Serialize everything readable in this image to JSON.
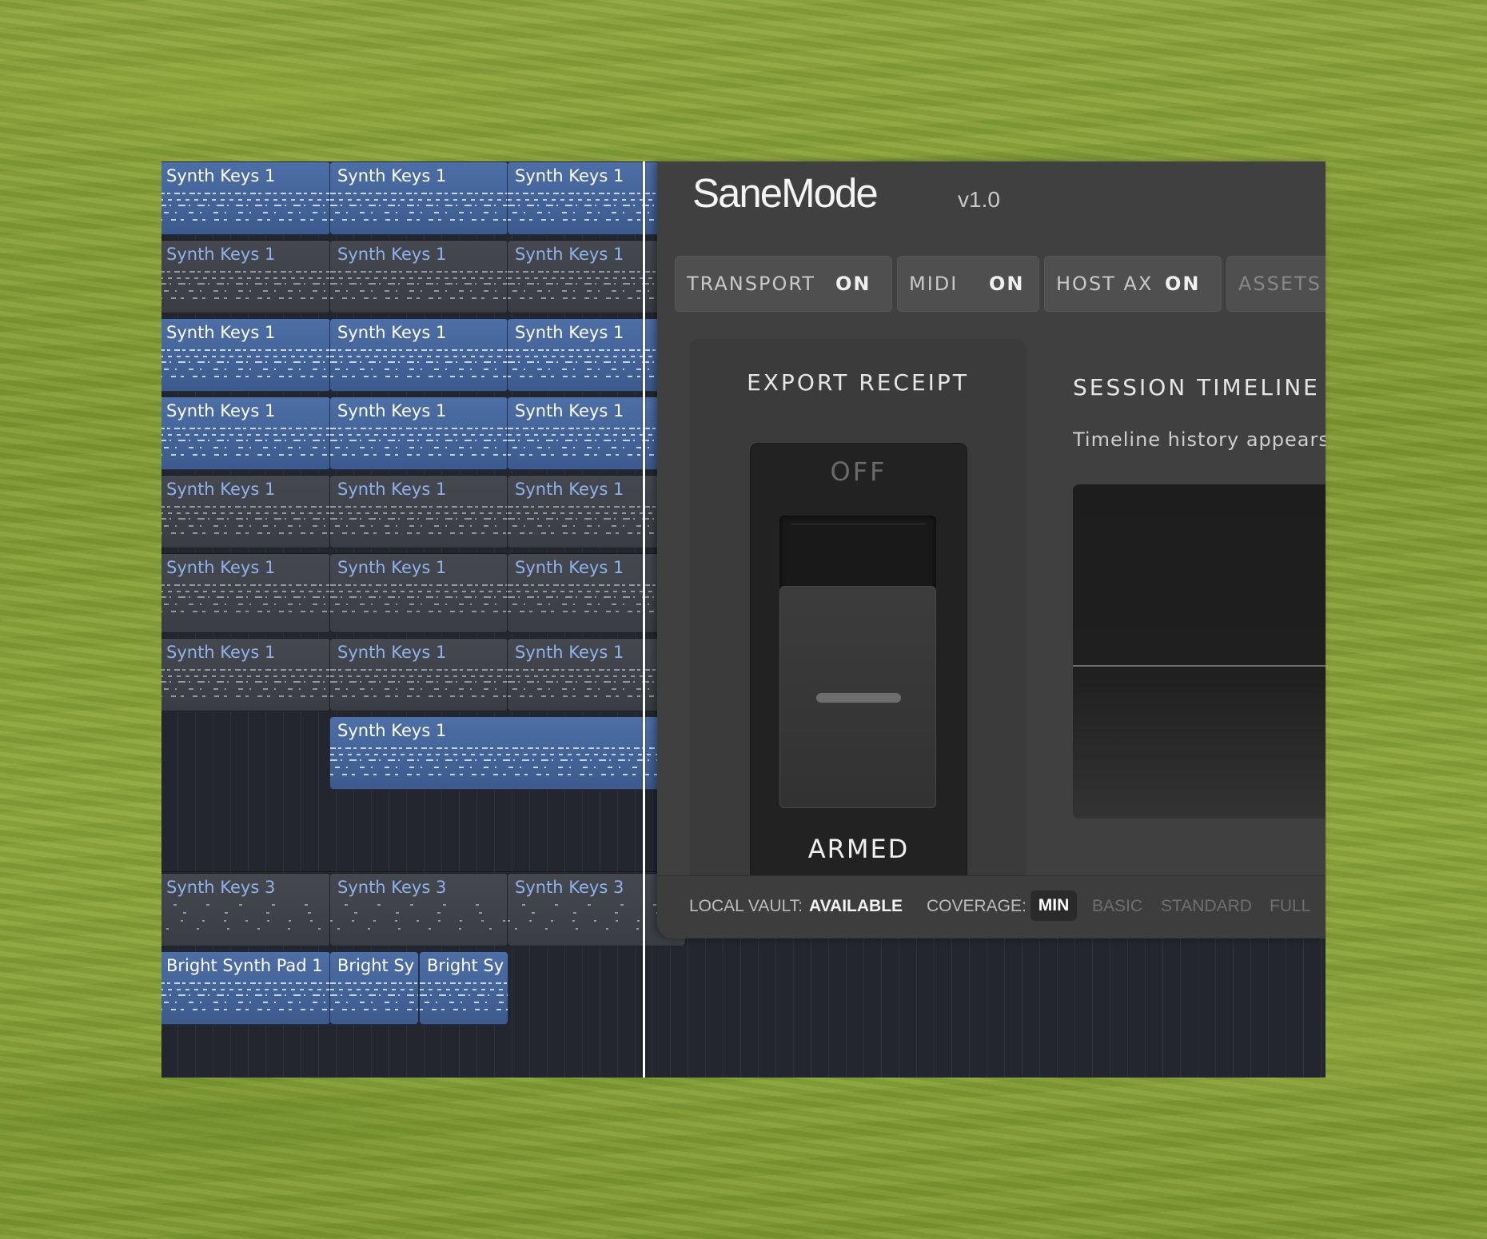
{
  "daw": {
    "rows": [
      {
        "style": "blue",
        "clips": [
          "Synth Keys 1",
          "Synth Keys 1",
          "Synth Keys 1"
        ]
      },
      {
        "style": "gray",
        "clips": [
          "Synth Keys 1",
          "Synth Keys 1",
          "Synth Keys 1"
        ]
      },
      {
        "style": "blue",
        "clips": [
          "Synth Keys 1",
          "Synth Keys 1",
          "Synth Keys 1"
        ]
      },
      {
        "style": "blue",
        "clips": [
          "Synth Keys 1",
          "Synth Keys 1",
          "Synth Keys 1"
        ]
      },
      {
        "style": "gray",
        "clips": [
          "Synth Keys 1",
          "Synth Keys 1",
          "Synth Keys 1"
        ]
      },
      {
        "style": "gray",
        "clips": [
          "Synth Keys 1",
          "Synth Keys 1",
          "Synth Keys 1"
        ]
      },
      {
        "style": "gray",
        "clips": [
          "Synth Keys 1",
          "Synth Keys 1",
          "Synth Keys 1"
        ]
      }
    ],
    "row8_clip": "Synth Keys 1",
    "row10": [
      "Synth Keys 3",
      "Synth Keys 3",
      "Synth Keys 3"
    ],
    "row11": [
      "Bright Synth Pad 1",
      "Bright Sy",
      "Bright Sy"
    ]
  },
  "panel": {
    "brand": "SaneMode",
    "version": "v1.0",
    "services": [
      {
        "name": "TRANSPORT",
        "state": "ON"
      },
      {
        "name": "MIDI",
        "state": "ON"
      },
      {
        "name": "HOST AX",
        "state": "ON"
      },
      {
        "name": "ASSETS",
        "state": ""
      }
    ],
    "export_receipt": {
      "title": "EXPORT RECEIPT",
      "off_label": "OFF",
      "armed_label": "ARMED"
    },
    "session_timeline": {
      "title": "SESSION TIMELINE",
      "hint": "Timeline history appears a"
    },
    "footer": {
      "vault_label": "LOCAL VAULT:",
      "vault_value": "AVAILABLE",
      "coverage_label": "COVERAGE:",
      "coverage_options": [
        "MIN",
        "BASIC",
        "STANDARD",
        "FULL"
      ],
      "coverage_selected": "MIN"
    }
  },
  "colors": {
    "clip_blue": "#4d6fa6",
    "clip_gray": "#45484f",
    "panel_bg": "#404040",
    "grass": "#8ca33c"
  }
}
